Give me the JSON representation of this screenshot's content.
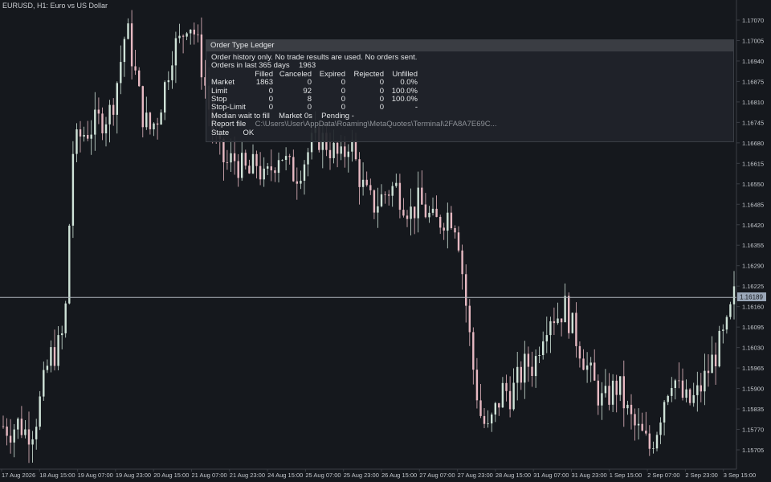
{
  "window": {
    "symbol_label": "EURUSD, H1:  Euro vs US Dollar"
  },
  "price_axis": {
    "labels": [
      "1.17070",
      "1.17005",
      "1.16940",
      "1.16875",
      "1.16810",
      "1.16745",
      "1.16680",
      "1.16615",
      "1.16550",
      "1.16485",
      "1.16420",
      "1.16355",
      "1.16290",
      "1.16225",
      "1.16160",
      "1.16095",
      "1.16030",
      "1.15965",
      "1.15900",
      "1.15835",
      "1.15770",
      "1.15705"
    ],
    "current_price": "1.16189"
  },
  "time_axis": {
    "labels": [
      "17 Aug 2026",
      "18 Aug 15:00",
      "19 Aug 07:00",
      "19 Aug 23:00",
      "20 Aug 15:00",
      "21 Aug 07:00",
      "21 Aug 23:00",
      "24 Aug 15:00",
      "25 Aug 07:00",
      "25 Aug 23:00",
      "26 Aug 15:00",
      "27 Aug 07:00",
      "27 Aug 23:00",
      "28 Aug 15:00",
      "31 Aug 07:00",
      "31 Aug 23:00",
      "1 Sep 15:00",
      "2 Sep 07:00",
      "2 Sep 23:00",
      "3 Sep 15:00"
    ]
  },
  "colors": {
    "background": "#15181d",
    "bull_candle": "#cfe3d8",
    "bear_candle": "#e7b9c2",
    "crosshair": "#aeb4bc",
    "price_tag": "#9aa7b8"
  },
  "panel": {
    "title": "Order Type Ledger",
    "note": "Order history only. No trade results are used. No orders sent.",
    "orders_label": "Orders in last 365 days",
    "orders_count": "1963",
    "columns": [
      "Filled",
      "Canceled",
      "Expired",
      "Rejected",
      "Unfilled"
    ],
    "rows": [
      {
        "type": "Market",
        "filled": "1863",
        "canceled": "0",
        "expired": "0",
        "rejected": "0",
        "unfilled": "0.0%"
      },
      {
        "type": "Limit",
        "filled": "0",
        "canceled": "92",
        "expired": "0",
        "rejected": "0",
        "unfilled": "100.0%"
      },
      {
        "type": "Stop",
        "filled": "0",
        "canceled": "8",
        "expired": "0",
        "rejected": "0",
        "unfilled": "100.0%"
      },
      {
        "type": "Stop-Limit",
        "filled": "0",
        "canceled": "0",
        "expired": "0",
        "rejected": "0",
        "unfilled": "-"
      }
    ],
    "median_label": "Median wait to fill",
    "median_market_label": "Market",
    "median_market_value": "0s",
    "median_pending_label": "Pending",
    "median_pending_value": "-",
    "report_label": "Report file",
    "report_path": "C:\\Users\\User\\AppData\\Roaming\\MetaQuotes\\Terminal\\2FA8A7E69C...",
    "state_label": "State",
    "state_value": "OK"
  },
  "chart_data": {
    "type": "candlestick",
    "symbol": "EURUSD",
    "timeframe": "H1",
    "ylim": [
      1.1568,
      1.1712
    ],
    "current_price": 1.16189,
    "x": [
      "17 Aug 2026",
      "18 Aug 15:00",
      "19 Aug 07:00",
      "19 Aug 23:00",
      "20 Aug 15:00",
      "21 Aug 07:00",
      "21 Aug 23:00",
      "24 Aug 15:00",
      "25 Aug 07:00",
      "25 Aug 23:00",
      "26 Aug 15:00",
      "27 Aug 07:00",
      "27 Aug 23:00",
      "28 Aug 15:00",
      "31 Aug 07:00",
      "31 Aug 23:00",
      "1 Sep 15:00",
      "2 Sep 07:00",
      "2 Sep 23:00",
      "3 Sep 15:00"
    ],
    "close_path": [
      1.1578,
      1.1577,
      1.1579,
      1.1576,
      1.1578,
      1.1588,
      1.16,
      1.1602,
      1.1609,
      1.1665,
      1.167,
      1.1672,
      1.1674,
      1.1676,
      1.1678,
      1.169,
      1.1705,
      1.1692,
      1.1678,
      1.1672,
      1.1676,
      1.1686,
      1.1698,
      1.17,
      1.1708,
      1.1702,
      1.169,
      1.1675,
      1.1665,
      1.1661,
      1.1663,
      1.166,
      1.1658,
      1.1662,
      1.1655,
      1.1661,
      1.1666,
      1.166,
      1.1658,
      1.1662,
      1.1667,
      1.167,
      1.1668,
      1.1665,
      1.1662,
      1.167,
      1.166,
      1.1652,
      1.1648,
      1.165,
      1.1653,
      1.1654,
      1.165,
      1.1646,
      1.1649,
      1.1646,
      1.1642,
      1.1644,
      1.1646,
      1.1642,
      1.162,
      1.1598,
      1.1582,
      1.1576,
      1.1583,
      1.159,
      1.1588,
      1.1593,
      1.1598,
      1.1597,
      1.1608,
      1.1614,
      1.1613,
      1.1616,
      1.1609,
      1.1603,
      1.1596,
      1.159,
      1.1585,
      1.1589,
      1.1591,
      1.1583,
      1.1578,
      1.1575,
      1.1571,
      1.1578,
      1.1588,
      1.1595,
      1.1588,
      1.1585,
      1.1587,
      1.1592,
      1.1598,
      1.1603,
      1.1608,
      1.1619
    ]
  }
}
